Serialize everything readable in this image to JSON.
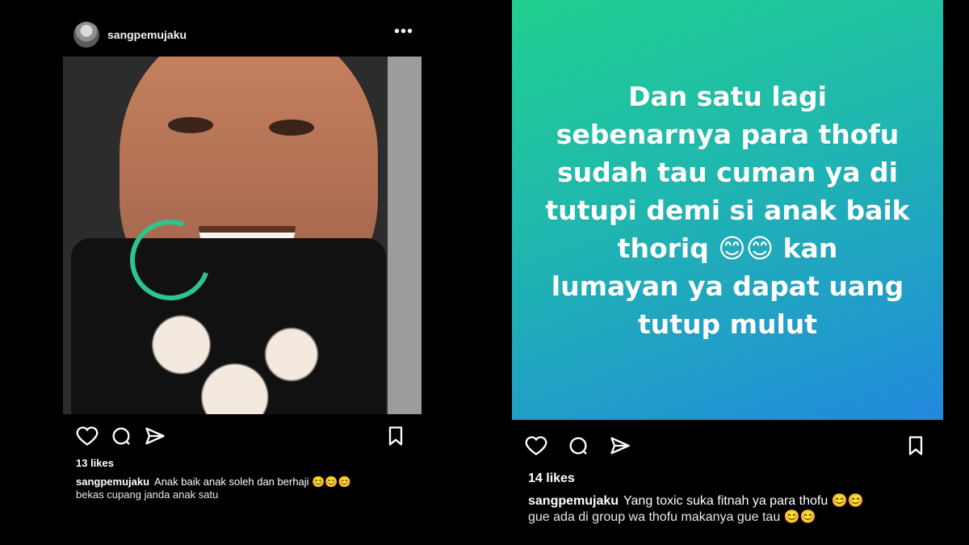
{
  "left_post": {
    "username": "sangpemujaku",
    "more_label": "•••",
    "likes": "13 likes",
    "caption_user": "sangpemujaku",
    "caption_line1": "Anak baik anak soleh dan berhaji 😊😊😊",
    "caption_line2": "bekas cupang janda anak satu",
    "icons": [
      "heart-icon",
      "comment-icon",
      "share-icon",
      "bookmark-icon"
    ],
    "highlight_color": "#2ec48b"
  },
  "right_post": {
    "story_text": "Dan satu lagi\nsebenarnya para thofu\nsudah tau cuman ya di\ntutupi demi si anak baik\nthoriq 😊😊 kan\nlumayan ya dapat uang\ntutup mulut",
    "likes": "14 likes",
    "caption_user": "sangpemujaku",
    "caption_line1": "Yang toxic suka fitnah ya para thofu 😊😊",
    "caption_line2": "gue ada di group wa thofu makanya gue tau 😊😊",
    "icons": [
      "heart-icon",
      "comment-icon",
      "share-icon",
      "bookmark-icon"
    ],
    "gradient": [
      "#21d08f",
      "#1fb6b0",
      "#2189dd"
    ]
  }
}
